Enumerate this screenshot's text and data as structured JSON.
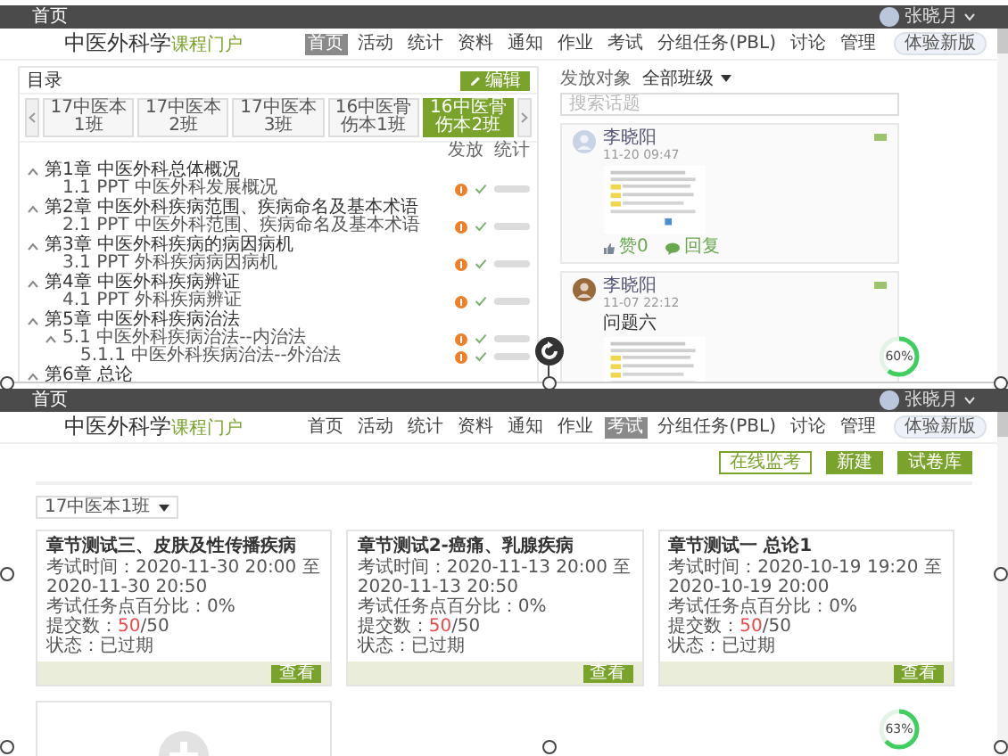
{
  "top_screen": {
    "topbar": {
      "home": "首页",
      "user": "张晓月"
    },
    "header": {
      "course": "中医外科学",
      "portal": "课程门户",
      "nav": [
        {
          "label": "首页",
          "selected": true
        },
        {
          "label": "活动",
          "selected": false
        },
        {
          "label": "统计",
          "selected": false
        },
        {
          "label": "资料",
          "selected": false
        },
        {
          "label": "通知",
          "selected": false
        },
        {
          "label": "作业",
          "selected": false
        },
        {
          "label": "考试",
          "selected": false
        },
        {
          "label": "分组任务(PBL)",
          "selected": false
        },
        {
          "label": "讨论",
          "selected": false
        },
        {
          "label": "管理",
          "selected": false
        }
      ],
      "new_version": "体验新版"
    },
    "catalog": {
      "title": "目录",
      "edit": "编辑",
      "tabs": [
        {
          "label": "17中医本1班",
          "selected": false
        },
        {
          "label": "17中医本2班",
          "selected": false
        },
        {
          "label": "17中医本3班",
          "selected": false
        },
        {
          "label": "16中医骨伤本1班",
          "selected": false
        },
        {
          "label": "16中医骨伤本2班",
          "selected": true
        }
      ],
      "columns": [
        "发放",
        "统计"
      ],
      "chapters": [
        {
          "title": "第1章 中医外科总体概况",
          "expanded": true,
          "children": [
            {
              "title": "1.1 PPT 中医外科发展概况"
            }
          ]
        },
        {
          "title": "第2章 中医外科疾病范围、疾病命名及基本术语",
          "expanded": true,
          "children": [
            {
              "title": "2.1 PPT 中医外科范围、疾病命名及基本术语"
            }
          ]
        },
        {
          "title": "第3章 中医外科疾病的病因病机",
          "expanded": true,
          "children": [
            {
              "title": "3.1 PPT 外科疾病病因病机"
            }
          ]
        },
        {
          "title": "第4章 中医外科疾病辨证",
          "expanded": true,
          "children": [
            {
              "title": "4.1 PPT 外科疾病辨证"
            }
          ]
        },
        {
          "title": "第5章 中医外科疾病治法",
          "expanded": true,
          "children": [
            {
              "title": "5.1 中医外科疾病治法--内治法",
              "expanded": true,
              "children": [
                {
                  "title": "5.1.1 中医外科疾病治法--外治法"
                }
              ]
            }
          ]
        },
        {
          "title": "第6章 总论",
          "expanded": true
        }
      ]
    },
    "discussion": {
      "target_label": "发放对象",
      "target": "全部班级",
      "search_placeholder": "搜索话题",
      "posts": [
        {
          "author": "李晓阳",
          "time": "11-20 09:47",
          "color": "#c9d3e6",
          "like": "赞0",
          "reply": "回复"
        },
        {
          "author": "李晓阳",
          "time": "11-07 22:12",
          "color": "#9a6a3a",
          "text": "问题六"
        }
      ]
    },
    "progress": {
      "level": 0.6,
      "text": "60%"
    }
  },
  "bottom_screen": {
    "topbar": {
      "home": "首页",
      "user": "张晓月"
    },
    "header": {
      "course": "中医外科学",
      "portal": "课程门户",
      "nav": [
        {
          "label": "首页",
          "selected": false
        },
        {
          "label": "活动",
          "selected": false
        },
        {
          "label": "统计",
          "selected": false
        },
        {
          "label": "资料",
          "selected": false
        },
        {
          "label": "通知",
          "selected": false
        },
        {
          "label": "作业",
          "selected": false
        },
        {
          "label": "考试",
          "selected": true
        },
        {
          "label": "分组任务(PBL)",
          "selected": false
        },
        {
          "label": "讨论",
          "selected": false
        },
        {
          "label": "管理",
          "selected": false
        }
      ],
      "new_version": "体验新版"
    },
    "actions": [
      {
        "label": "在线监考",
        "kind": "outline"
      },
      {
        "label": "新建",
        "kind": "filled"
      },
      {
        "label": "试卷库",
        "kind": "filled"
      }
    ],
    "class_select": "17中医本1班",
    "exams": [
      {
        "title": "章节测试三、皮肤及性传播疾病",
        "time": "考试时间：2020-11-30 20:00 至 2020-11-30 20:50",
        "percent": "考试任务点百分比：0%",
        "submissions": {
          "label": "提交数：",
          "done": "50",
          "total": "/50"
        },
        "status": "状态：已过期",
        "view": "查看"
      },
      {
        "title": "章节测试2-癌痛、乳腺疾病",
        "time": "考试时间：2020-11-13 20:00 至 2020-11-13 20:50",
        "percent": "考试任务点百分比：0%",
        "submissions": {
          "label": "提交数：",
          "done": "50",
          "total": "/50"
        },
        "status": "状态：已过期",
        "view": "查看"
      },
      {
        "title": "章节测试一 总论1",
        "time": "考试时间：2020-10-19 19:20 至 2020-10-19 20:00",
        "percent": "考试任务点百分比：0%",
        "submissions": {
          "label": "提交数：",
          "done": "50",
          "total": "/50"
        },
        "status": "状态：已过期",
        "view": "查看"
      }
    ],
    "progress": {
      "level": 0.63,
      "text": "63%"
    }
  }
}
